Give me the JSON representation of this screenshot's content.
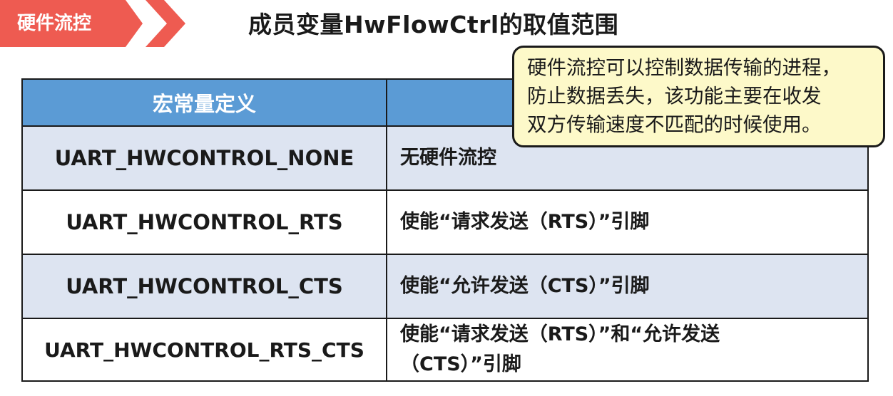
{
  "tag": {
    "label": "硬件流控"
  },
  "slide": {
    "title": "成员变量HwFlowCtrl的取值范围"
  },
  "callout": {
    "lines": [
      "硬件流控可以控制数据传输的进程，",
      "防止数据丢失，该功能主要在收发",
      "双方传输速度不匹配的时候使用。"
    ]
  },
  "table": {
    "header": {
      "col1": "宏常量定义",
      "col2": ""
    },
    "rows": [
      {
        "constant": "UART_HWCONTROL_NONE",
        "meaning": "无硬件流控"
      },
      {
        "constant": "UART_HWCONTROL_RTS",
        "meaning": "使能“请求发送（RTS）”引脚"
      },
      {
        "constant": "UART_HWCONTROL_CTS",
        "meaning": "使能“允许发送（CTS）”引脚"
      },
      {
        "constant": "UART_HWCONTROL_RTS_CTS",
        "meaning": "使能“请求发送（RTS）”和“允许发送（CTS）”引脚"
      }
    ]
  }
}
